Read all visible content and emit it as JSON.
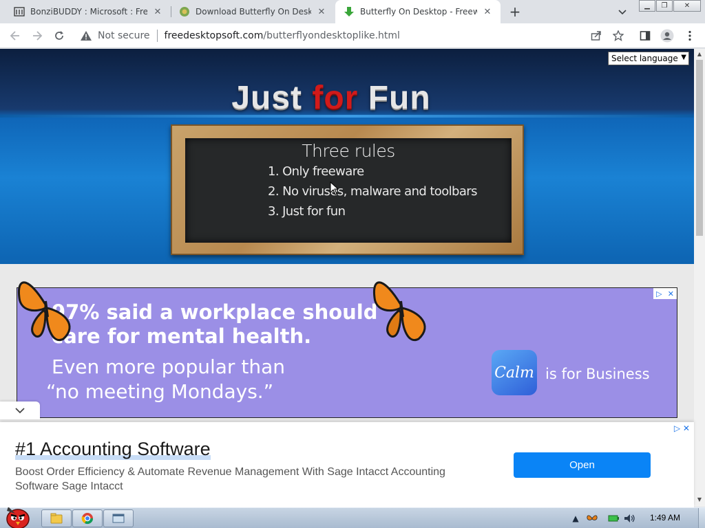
{
  "browser": {
    "tabs": [
      {
        "title": "BonziBUDDY : Microsoft : Free",
        "favicon": "archive-icon",
        "active": false
      },
      {
        "title": "Download Butterfly On Deskto",
        "favicon": "site-icon",
        "active": false
      },
      {
        "title": "Butterfly On Desktop - Freewa",
        "favicon": "download-icon",
        "active": true
      }
    ],
    "new_tab_symbol": "+",
    "security_label": "Not secure",
    "url_domain": "freedesktopsoft.com",
    "url_path": "/butterflyondesktoplike.html"
  },
  "page": {
    "language_select": "Select language",
    "logo": {
      "word1": "Just",
      "word2": "for",
      "word3": "Fun"
    },
    "board": {
      "heading": "Three rules",
      "rules": [
        "1. Only freeware",
        "2. No viruses, malware and toolbars",
        "3. Just for fun"
      ]
    },
    "ad_top": {
      "line1": "97% said a workplace should",
      "line2": "care for mental health.",
      "line3": "Even more popular than",
      "line4": "“no meeting Mondays.”",
      "brand": "Calm",
      "brand_tagline": "is for Business",
      "colors": {
        "background": "#9b8fe6"
      }
    },
    "ad_bottom": {
      "title": "#1 Accounting Software",
      "description": "Boost Order Efficiency & Automate Revenue Management With Sage Intacct Accounting Software Sage Intacct",
      "button": "Open",
      "colors": {
        "button": "#0a84f6"
      }
    }
  },
  "taskbar": {
    "clock": "1:49 AM"
  }
}
